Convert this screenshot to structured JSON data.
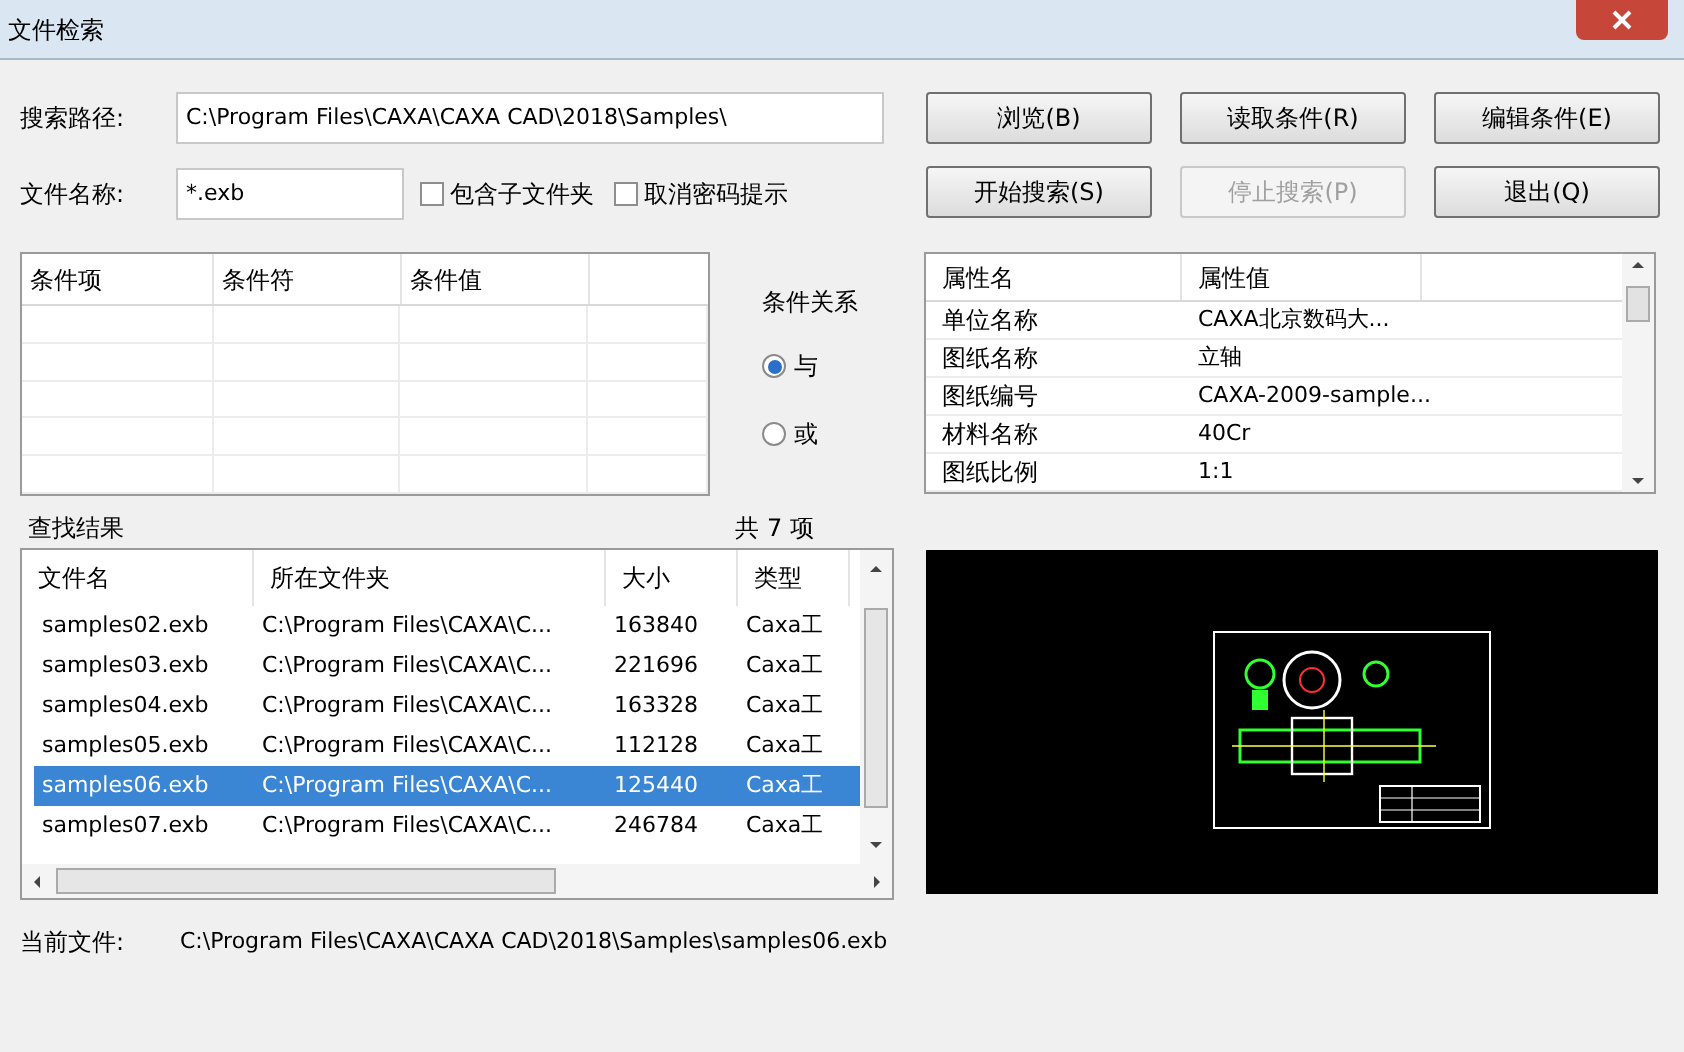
{
  "window": {
    "title": "文件检索"
  },
  "search": {
    "path_label": "搜索路径:",
    "path_value": "C:\\Program Files\\CAXA\\CAXA CAD\\2018\\Samples\\",
    "name_label": "文件名称:",
    "name_value": "*.exb",
    "options": [
      {
        "label": "包含子文件夹",
        "checked": false
      },
      {
        "label": "取消密码提示",
        "checked": false
      }
    ]
  },
  "buttons": [
    {
      "label": "浏览(B)",
      "disabled": false
    },
    {
      "label": "读取条件(R)",
      "disabled": false
    },
    {
      "label": "编辑条件(E)",
      "disabled": false
    },
    {
      "label": "开始搜索(S)",
      "disabled": false
    },
    {
      "label": "停止搜索(P)",
      "disabled": true
    },
    {
      "label": "退出(Q)",
      "disabled": false
    }
  ],
  "conditions": {
    "columns": [
      "条件项",
      "条件符",
      "条件值"
    ]
  },
  "relation": {
    "label": "条件关系",
    "options": [
      {
        "label": "与",
        "selected": true
      },
      {
        "label": "或",
        "selected": false
      }
    ]
  },
  "properties": {
    "columns": [
      "属性名",
      "属性值"
    ],
    "rows": [
      {
        "name": "单位名称",
        "value": "CAXA北京数码大..."
      },
      {
        "name": "图纸名称",
        "value": "立轴"
      },
      {
        "name": "图纸编号",
        "value": "CAXA-2009-sample..."
      },
      {
        "name": "材料名称",
        "value": "40Cr"
      },
      {
        "name": "图纸比例",
        "value": "1:1"
      }
    ]
  },
  "results": {
    "label": "查找结果",
    "count": "共 7 项",
    "columns": [
      "文件名",
      "所在文件夹",
      "大小",
      "类型"
    ],
    "rows": [
      {
        "cells": [
          "samples02.exb",
          "C:\\Program Files\\CAXA\\C...",
          "163840",
          "Caxa工"
        ],
        "selected": false
      },
      {
        "cells": [
          "samples03.exb",
          "C:\\Program Files\\CAXA\\C...",
          "221696",
          "Caxa工"
        ],
        "selected": false
      },
      {
        "cells": [
          "samples04.exb",
          "C:\\Program Files\\CAXA\\C...",
          "163328",
          "Caxa工"
        ],
        "selected": false
      },
      {
        "cells": [
          "samples05.exb",
          "C:\\Program Files\\CAXA\\C...",
          "112128",
          "Caxa工"
        ],
        "selected": false
      },
      {
        "cells": [
          "samples06.exb",
          "C:\\Program Files\\CAXA\\C...",
          "125440",
          "Caxa工"
        ],
        "selected": true
      },
      {
        "cells": [
          "samples07.exb",
          "C:\\Program Files\\CAXA\\C...",
          "246784",
          "Caxa工"
        ],
        "selected": false
      }
    ]
  },
  "current_file": {
    "label": "当前文件:",
    "value": "C:\\Program Files\\CAXA\\CAXA CAD\\2018\\Samples\\samples06.exb"
  }
}
